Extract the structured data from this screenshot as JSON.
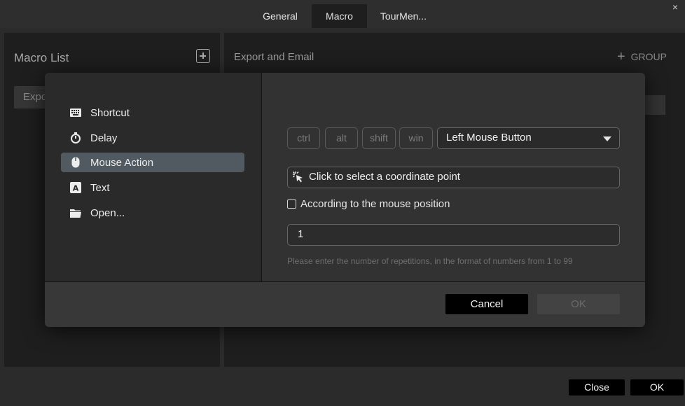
{
  "tabs": [
    {
      "label": "General",
      "active": false
    },
    {
      "label": "Macro",
      "active": true
    },
    {
      "label": "TourMen...",
      "active": false
    }
  ],
  "window": {
    "close_glyph": "×"
  },
  "left_panel": {
    "title": "Macro List",
    "add_icon": "plus-square-icon",
    "items": [
      {
        "label": "Expo"
      }
    ]
  },
  "right_panel": {
    "title": "Export and Email",
    "group_label": "GROUP",
    "group_icon": "plus-icon"
  },
  "modal": {
    "menu": [
      {
        "label": "Shortcut",
        "icon": "keyboard-icon",
        "active": false
      },
      {
        "label": "Delay",
        "icon": "stopwatch-icon",
        "active": false
      },
      {
        "label": "Mouse Action",
        "icon": "mouse-icon",
        "active": true
      },
      {
        "label": "Text",
        "icon": "text-icon",
        "active": false
      },
      {
        "label": "Open...",
        "icon": "folder-icon",
        "active": false
      }
    ],
    "modifier_keys": [
      "ctrl",
      "alt",
      "shift",
      "win"
    ],
    "mouse_button": {
      "selected": "Left Mouse Button"
    },
    "coordinate_field": {
      "label": "Click to select a coordinate point",
      "icon": "cursor-click-icon"
    },
    "follow_mouse": {
      "label": "According to the mouse position",
      "checked": false
    },
    "repetitions": {
      "value": "1",
      "hint": "Please enter the number of repetitions, in the format of numbers from 1 to 99"
    },
    "cancel_label": "Cancel",
    "ok_label": "OK"
  },
  "footer": {
    "close_label": "Close",
    "ok_label": "OK"
  },
  "colors": {
    "background": "#2b2b2b",
    "panel": "#1e1e1e",
    "modal": "#2a2a2a",
    "active_menu": "#505a60",
    "button_black": "#000000"
  }
}
